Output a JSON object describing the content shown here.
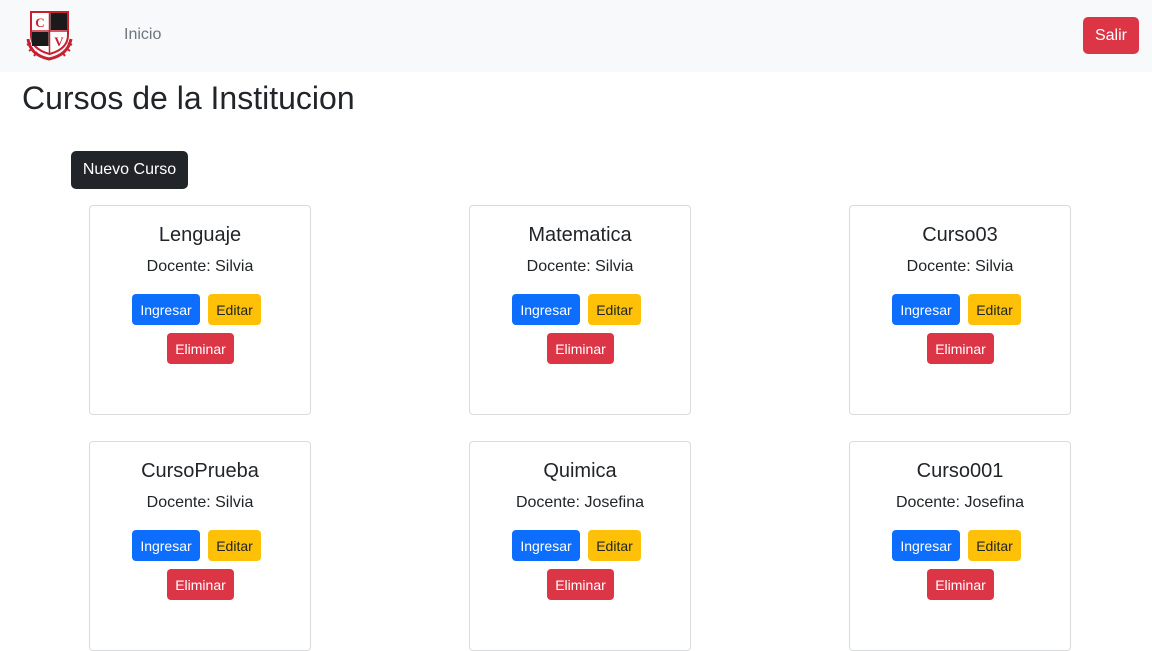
{
  "navbar": {
    "logo_letters": "CV",
    "link_home": "Inicio",
    "logout_label": "Salir"
  },
  "page": {
    "title": "Cursos de la Institucion",
    "new_course_label": "Nuevo Curso"
  },
  "courses": [
    {
      "name": "Lenguaje",
      "teacher": "Docente: Silvia",
      "enter": "Ingresar",
      "edit": "Editar",
      "delete": "Eliminar"
    },
    {
      "name": "Matematica",
      "teacher": "Docente: Silvia",
      "enter": "Ingresar",
      "edit": "Editar",
      "delete": "Eliminar"
    },
    {
      "name": "Curso03",
      "teacher": "Docente: Silvia",
      "enter": "Ingresar",
      "edit": "Editar",
      "delete": "Eliminar"
    },
    {
      "name": "CursoPrueba",
      "teacher": "Docente: Silvia",
      "enter": "Ingresar",
      "edit": "Editar",
      "delete": "Eliminar"
    },
    {
      "name": "Quimica",
      "teacher": "Docente: Josefina",
      "enter": "Ingresar",
      "edit": "Editar",
      "delete": "Eliminar"
    },
    {
      "name": "Curso001",
      "teacher": "Docente: Josefina",
      "enter": "Ingresar",
      "edit": "Editar",
      "delete": "Eliminar"
    }
  ],
  "colors": {
    "primary": "#0d6efd",
    "warning": "#ffc107",
    "danger": "#dc3545",
    "dark": "#212529",
    "navbar_bg": "#f8f9fa"
  }
}
